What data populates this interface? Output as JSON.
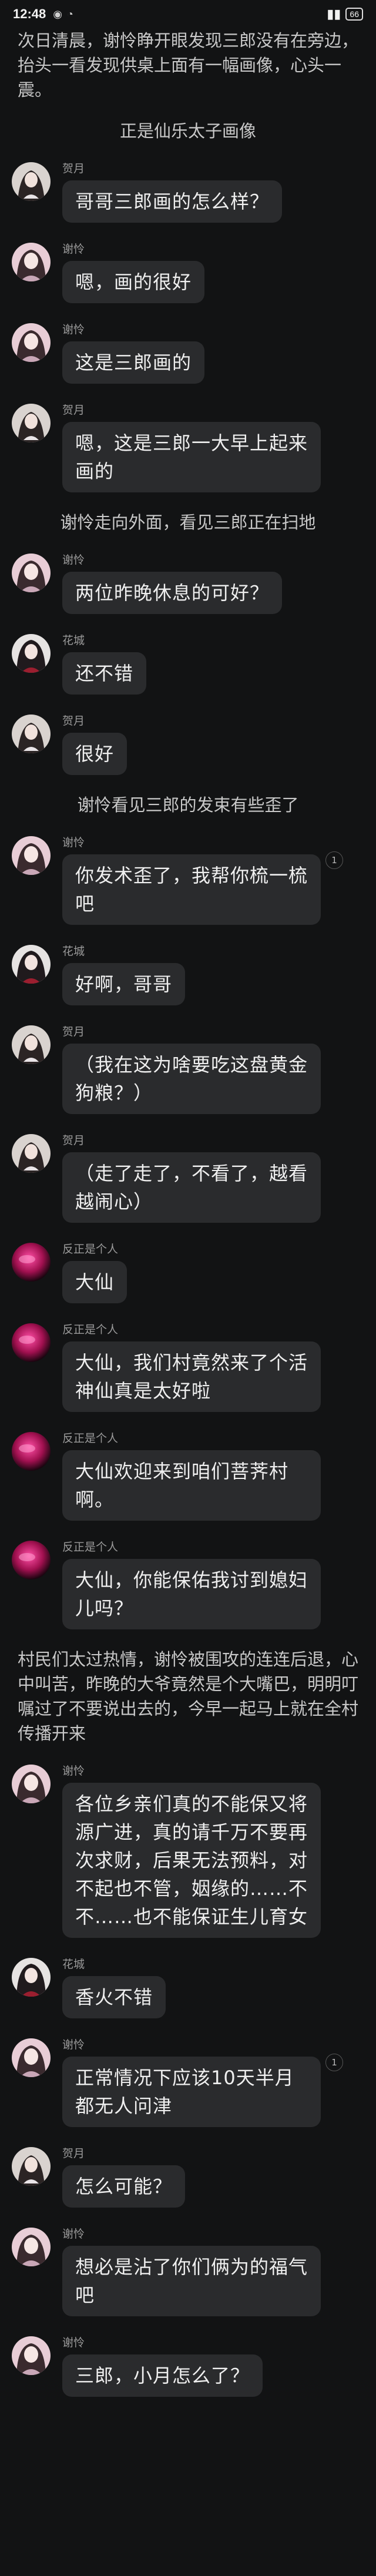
{
  "status": {
    "time": "12:48",
    "battery": "66"
  },
  "items": [
    {
      "kind": "narration",
      "align": "left",
      "text": "次日清晨，谢怜睁开眼发现三郎没有在旁边，抬头一看发现供桌上面有一幅画像，心头一震。"
    },
    {
      "kind": "narration",
      "align": "center",
      "text": "正是仙乐太子画像"
    },
    {
      "kind": "msg",
      "avatar": "heyue",
      "name": "贺月",
      "text": "哥哥三郎画的怎么样？"
    },
    {
      "kind": "msg",
      "avatar": "xielian",
      "name": "谢怜",
      "text": "嗯，画的很好"
    },
    {
      "kind": "msg",
      "avatar": "xielian",
      "name": "谢怜",
      "text": "这是三郎画的"
    },
    {
      "kind": "msg",
      "avatar": "heyue",
      "name": "贺月",
      "text": "嗯，这是三郎一大早上起来画的"
    },
    {
      "kind": "narration",
      "align": "center",
      "text": "谢怜走向外面，看见三郎正在扫地"
    },
    {
      "kind": "msg",
      "avatar": "xielian",
      "name": "谢怜",
      "text": "两位昨晚休息的可好？"
    },
    {
      "kind": "msg",
      "avatar": "huacheng",
      "name": "花城",
      "text": "还不错"
    },
    {
      "kind": "msg",
      "avatar": "heyue",
      "name": "贺月",
      "text": "很好"
    },
    {
      "kind": "narration",
      "align": "center",
      "text": "谢怜看见三郎的发束有些歪了"
    },
    {
      "kind": "msg",
      "avatar": "xielian",
      "name": "谢怜",
      "text": "你发术歪了，我帮你梳一梳吧",
      "badge": "1"
    },
    {
      "kind": "msg",
      "avatar": "huacheng",
      "name": "花城",
      "text": "好啊，哥哥"
    },
    {
      "kind": "msg",
      "avatar": "heyue",
      "name": "贺月",
      "text": "（我在这为啥要吃这盘黄金狗粮？）"
    },
    {
      "kind": "msg",
      "avatar": "heyue",
      "name": "贺月",
      "text": "（走了走了，不看了，越看越闹心）"
    },
    {
      "kind": "msg",
      "avatar": "pink",
      "name": "反正是个人",
      "text": "大仙"
    },
    {
      "kind": "msg",
      "avatar": "pink",
      "name": "反正是个人",
      "text": "大仙，我们村竟然来了个活神仙真是太好啦"
    },
    {
      "kind": "msg",
      "avatar": "pink",
      "name": "反正是个人",
      "text": "大仙欢迎来到咱们菩荠村啊。"
    },
    {
      "kind": "msg",
      "avatar": "pink",
      "name": "反正是个人",
      "text": "大仙，你能保佑我讨到媳妇儿吗？"
    },
    {
      "kind": "narration",
      "align": "left",
      "text": "村民们太过热情，谢怜被围攻的连连后退，心中叫苦，昨晚的大爷竟然是个大嘴巴，明明叮嘱过了不要说出去的，今早一起马上就在全村传播开来"
    },
    {
      "kind": "msg",
      "avatar": "xielian",
      "name": "谢怜",
      "text": "各位乡亲们真的不能保又将源广进，真的请千万不要再次求财，后果无法预料，对不起也不管，姻缘的……不不……也不能保证生儿育女"
    },
    {
      "kind": "msg",
      "avatar": "huacheng",
      "name": "花城",
      "text": "香火不错"
    },
    {
      "kind": "msg",
      "avatar": "xielian",
      "name": "谢怜",
      "text": "正常情况下应该10天半月都无人问津",
      "badge": "1"
    },
    {
      "kind": "msg",
      "avatar": "heyue",
      "name": "贺月",
      "text": "怎么可能？"
    },
    {
      "kind": "msg",
      "avatar": "xielian",
      "name": "谢怜",
      "text": "想必是沾了你们俩为的福气吧"
    },
    {
      "kind": "msg",
      "avatar": "xielian",
      "name": "谢怜",
      "text": "三郎，小月怎么了？"
    }
  ]
}
